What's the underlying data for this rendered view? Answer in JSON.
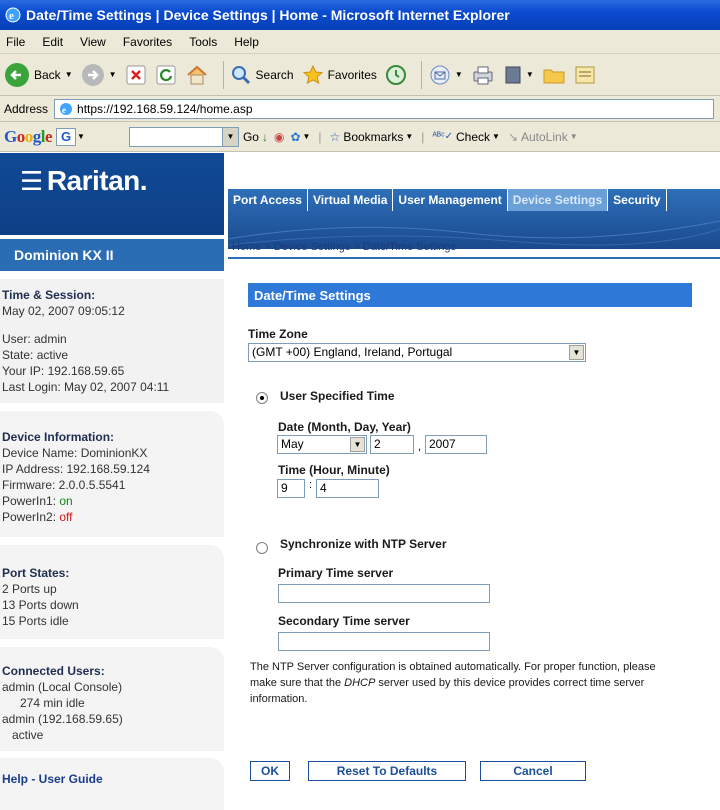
{
  "window": {
    "title": "Date/Time Settings | Device Settings | Home - Microsoft Internet Explorer"
  },
  "menu": [
    "File",
    "Edit",
    "View",
    "Favorites",
    "Tools",
    "Help"
  ],
  "toolbar": {
    "back": "Back",
    "search": "Search",
    "favorites": "Favorites"
  },
  "address": {
    "label": "Address",
    "url": "https://192.168.59.124/home.asp"
  },
  "google": {
    "logo": "Google",
    "go": "Go",
    "bookmarks": "Bookmarks",
    "check": "Check",
    "autolink": "AutoLink"
  },
  "brand": {
    "logo": "Raritan.",
    "product": "Dominion KX II"
  },
  "sidebar": {
    "session_title": "Time & Session:",
    "session_time": "May 02, 2007 09:05:12",
    "user": "User: admin",
    "state": "State: active",
    "ip": "Your IP: 192.168.59.65",
    "last_login": "Last Login: May 02, 2007 04:11",
    "device_title": "Device Information:",
    "device_name": "Device Name: DominionKX",
    "device_ip": "IP Address: 192.168.59.124",
    "firmware": "Firmware: 2.0.0.5.5541",
    "power1_label": "PowerIn1: ",
    "power1_val": "on",
    "power2_label": "PowerIn2: ",
    "power2_val": "off",
    "ports_title": "Port States:",
    "ports_up": "2 Ports up",
    "ports_down": "13 Ports down",
    "ports_idle": "15 Ports idle",
    "users_title": "Connected Users:",
    "user1": "admin (Local Console)",
    "user1_state": "274 min idle",
    "user2": "admin (192.168.59.65)",
    "user2_state": "active",
    "help": "Help - User Guide"
  },
  "tabs": [
    {
      "label": "Port Access"
    },
    {
      "label": "Virtual Media"
    },
    {
      "label": "User Management"
    },
    {
      "label": "Device Settings"
    },
    {
      "label": "Security"
    }
  ],
  "breadcrumb": {
    "home": "Home",
    "section": "Device Settings",
    "page": "Date/Time Settings",
    "sep": " > "
  },
  "form": {
    "heading": "Date/Time Settings",
    "tz_label": "Time Zone",
    "tz_value": "(GMT +00) England, Ireland, Portugal",
    "user_time_label": "User Specified Time",
    "date_label": "Date (Month, Day, Year)",
    "month": "May",
    "day": "2",
    "year": "2007",
    "time_label": "Time (Hour, Minute)",
    "hour": "9",
    "minute": "4",
    "ntp_label": "Synchronize with NTP Server",
    "primary_label": "Primary Time server",
    "primary_value": "",
    "secondary_label": "Secondary Time server",
    "secondary_value": "",
    "note_1": "The NTP Server configuration is obtained automatically. For proper function, please make sure that the ",
    "note_dhcp": "DHCP",
    "note_2": " server used by this device provides correct time server information.",
    "ok": "OK",
    "reset": "Reset To Defaults",
    "cancel": "Cancel"
  }
}
